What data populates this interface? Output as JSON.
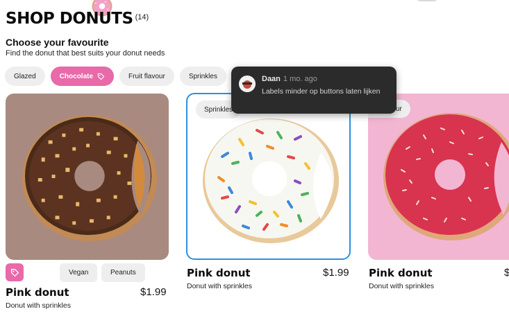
{
  "header": {
    "title": "SHOP DONUTS",
    "count": "(14)"
  },
  "intro": {
    "subtitle": "Choose your favourite",
    "description": "Find the donut that best suits your donut needs"
  },
  "filters": [
    {
      "label": "Glazed"
    },
    {
      "label": "Chocolate",
      "active": true,
      "icon": "tag-icon"
    },
    {
      "label": "Fruit flavour"
    },
    {
      "label": "Sprinkles"
    }
  ],
  "products": [
    {
      "image_bg": "#a88a80",
      "tags": [
        "Vegan",
        "Peanuts"
      ],
      "tag_icon": "tag-icon",
      "name": "Pink donut",
      "price": "$1.99",
      "description": "Donut with sprinkles"
    },
    {
      "image_bg": "#ffffff",
      "image_tag": "Sprinkles",
      "name": "Pink donut",
      "price": "$1.99",
      "description": "Donut with sprinkles"
    },
    {
      "image_bg": "#f2b6d3",
      "image_tag": "Fruit flavour",
      "name": "Pink donut",
      "price": "$",
      "description": "Donut with sprinkles"
    }
  ],
  "comment": {
    "author": "Daan",
    "time": "1 mo. ago",
    "text": "Labels minder op buttons laten lijken"
  },
  "colors": {
    "accent": "#e86aa9",
    "selected_border": "#2b8fe0",
    "comment_bg": "#2b2b2b"
  }
}
